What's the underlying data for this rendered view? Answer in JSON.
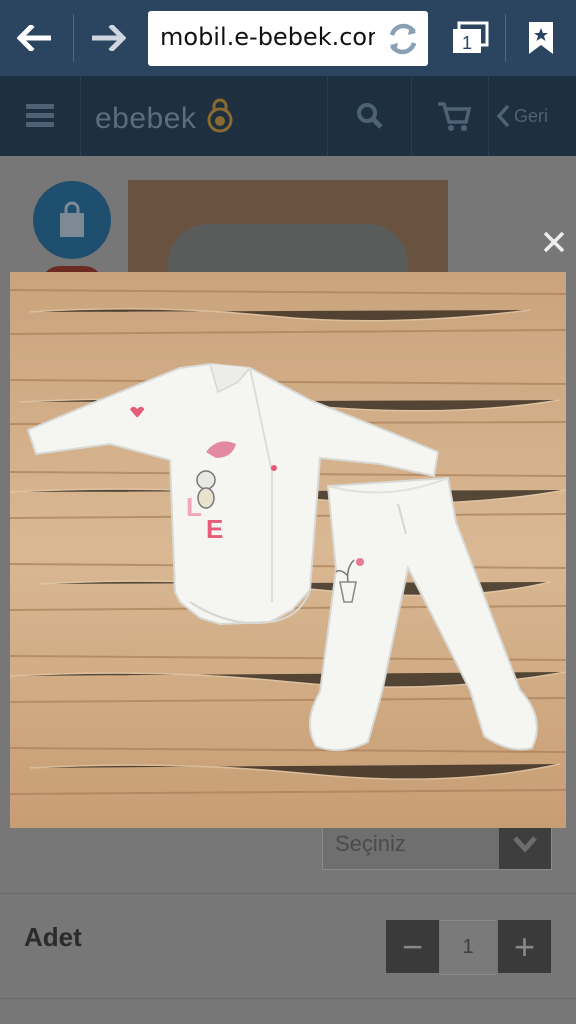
{
  "browser": {
    "url": "mobil.e-bebek.cor",
    "tab_count": "1",
    "back_icon": "arrow-left-icon",
    "forward_icon": "arrow-right-icon",
    "refresh_icon": "refresh-icon",
    "tabs_icon": "tabs-icon",
    "bookmark_icon": "bookmark-star-icon"
  },
  "header": {
    "logo": "ebebek",
    "back_label": "Geri",
    "menu_icon": "hamburger-menu-icon",
    "search_icon": "search-icon",
    "cart_icon": "cart-icon"
  },
  "product": {
    "size_select_value": "Seçiniz",
    "quantity_label": "Adet",
    "quantity_value": "1",
    "minus_label": "−",
    "plus_label": "+"
  },
  "modal": {
    "close_label": "×",
    "image_alt": "Baby bodysuit and footed pants set on wooden background",
    "print_text": "LOVE"
  },
  "colors": {
    "browser_bar": "#2b4561",
    "site_header": "#1e2f40",
    "accent_logo": "#d58a2a"
  }
}
